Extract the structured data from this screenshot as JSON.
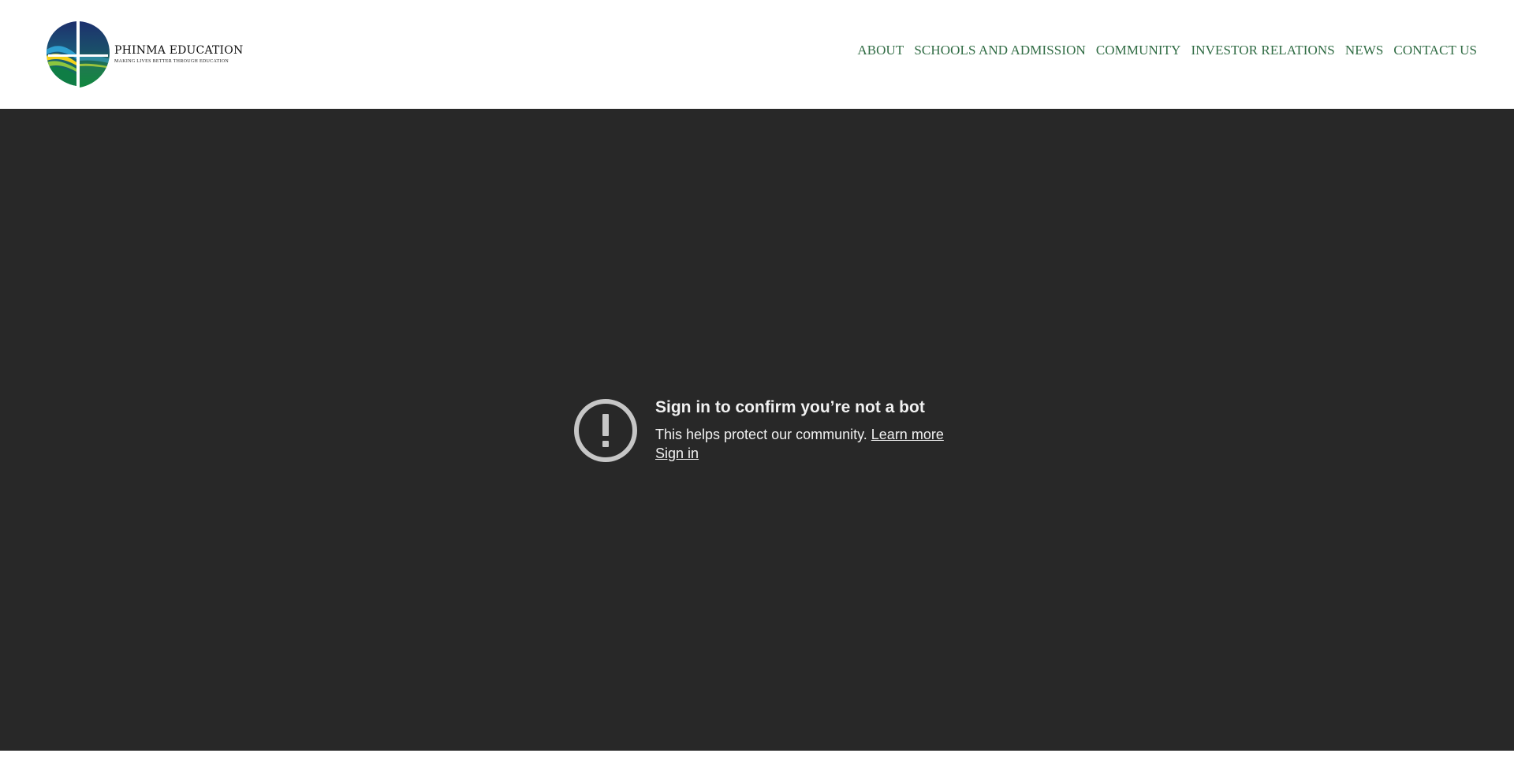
{
  "header": {
    "logo": {
      "name": "PHINMA EDUCATION",
      "tagline": "MAKING LIVES BETTER THROUGH EDUCATION"
    },
    "nav": [
      {
        "label": "ABOUT"
      },
      {
        "label": "SCHOOLS AND ADMISSION"
      },
      {
        "label": "COMMUNITY"
      },
      {
        "label": "INVESTOR RELATIONS"
      },
      {
        "label": "NEWS"
      },
      {
        "label": "CONTACT US"
      }
    ]
  },
  "video_embed": {
    "title": "Sign in to confirm you’re not a bot",
    "description": "This helps protect our community.",
    "learn_more": "Learn more",
    "sign_in": "Sign in",
    "icon": "alert-circle-icon"
  },
  "colors": {
    "nav_text": "#2f6b43",
    "video_bg": "#282828",
    "video_text": "#f1f1f1"
  }
}
